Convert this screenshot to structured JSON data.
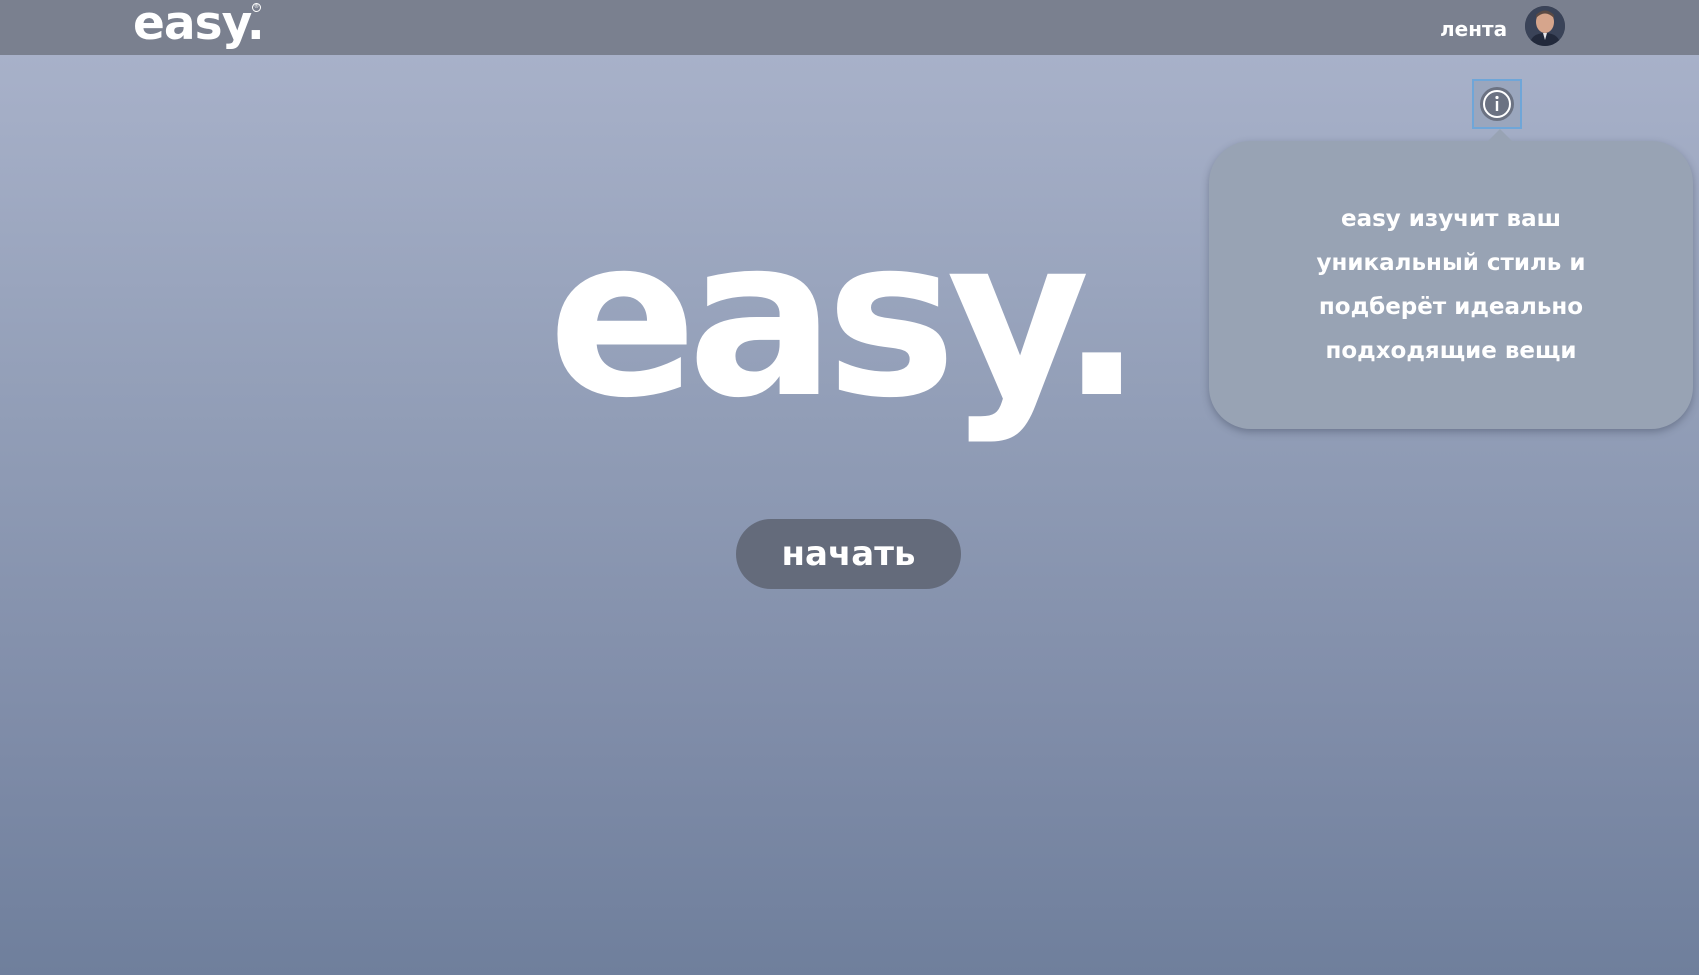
{
  "header": {
    "logo_text": "easy.",
    "logo_mark": "®",
    "nav_feed_label": "лента",
    "avatar_icon": "user-avatar"
  },
  "info": {
    "icon": "info-icon",
    "tooltip_text": "easy изучит ваш уникальный стиль и подберёт идеально подходящие вещи"
  },
  "hero": {
    "logo_text": "easy.",
    "start_label": "начать"
  },
  "colors": {
    "topbar": "#7a808f",
    "button": "#646b7b",
    "tooltip": "#98a3b4",
    "info_focus_border": "#6fa6d8"
  }
}
